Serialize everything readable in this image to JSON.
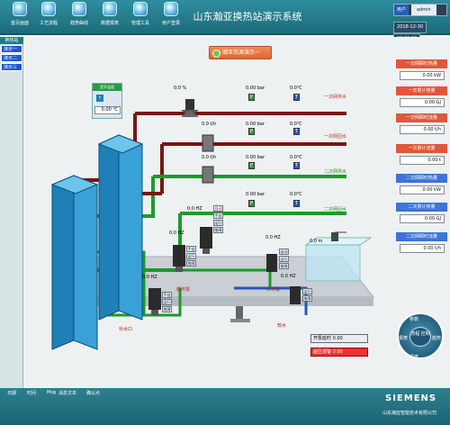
{
  "app": {
    "title": "山东瀚亚换热站演示系统"
  },
  "toolbar": {
    "buttons": [
      {
        "label": "首页画面",
        "icon": "home-icon"
      },
      {
        "label": "工艺流程",
        "icon": "flow-icon"
      },
      {
        "label": "趋势曲线",
        "icon": "chart-icon"
      },
      {
        "label": "数据报表",
        "icon": "report-icon"
      },
      {
        "label": "管理工具",
        "icon": "tools-icon"
      },
      {
        "label": "用户登录",
        "icon": "user-icon"
      }
    ]
  },
  "user": {
    "label": "用户",
    "name": "admin"
  },
  "datetime": {
    "date": "2018-12-30",
    "time": "20:35:15"
  },
  "sidebar": {
    "header": "换热站",
    "items": [
      "演示一",
      "演示二",
      "演示三"
    ]
  },
  "station": {
    "title": "瀚亚热源演示一"
  },
  "temp_box": {
    "title": "室外温度",
    "unit_icon": "t",
    "value": "0.00 ℃"
  },
  "right_panel": [
    {
      "label": "一次网瞬时热量",
      "value": "0.00 kW",
      "color": "red"
    },
    {
      "label": "一次累计热量",
      "value": "0.00 GJ",
      "color": "red"
    },
    {
      "label": "一次网瞬时流量",
      "value": "0.00 t/h",
      "color": "red"
    },
    {
      "label": "一次累计流量",
      "value": "0.00 t",
      "color": "red"
    },
    {
      "label": "二次网瞬时热量",
      "value": "0.00 kW",
      "color": "blue"
    },
    {
      "label": "二次累计热量",
      "value": "0.00 GJ",
      "color": "blue"
    },
    {
      "label": "二次网瞬时流量",
      "value": "0.00 t/h",
      "color": "blue"
    }
  ],
  "pipe_labels": {
    "primary_supply": "一次网供水",
    "primary_return": "一次网回水",
    "secondary_supply": "二次网供水",
    "secondary_return": "二次网回水"
  },
  "readings": {
    "valve_pct": "0.0 %",
    "p1": "0.00 bar",
    "t1": "0.0℃",
    "flow1": "0.0 t/h",
    "p2": "0.00 bar",
    "t2": "0.0℃",
    "flow2": "0.0 t/h",
    "p3": "0.00 bar",
    "t3": "0.0℃",
    "p4": "0.00 bar",
    "t4": "0.0℃",
    "hz_pump1": "0.0 HZ",
    "hz_pump2": "0.0 HZ",
    "hz_pump3": "0.0 HZ",
    "hz_pump4": "0.0 HZ",
    "hz_pump5": "0.0 HZ",
    "tank_level": "0.0 m"
  },
  "pump_state": {
    "auto": "自动",
    "manual": "手动",
    "run": "运行",
    "fault": "故障",
    "hand": "手自"
  },
  "devices": {
    "circ_pump": "循环泵",
    "makeup_pump": "补水泵",
    "softener": "软水",
    "refill_water": "补水口"
  },
  "status_boxes": {
    "pump_state": "开泵延时 0.00",
    "alarm": "超压报警 0.00"
  },
  "round_nav": {
    "top": "参数",
    "right": "趋势",
    "left": "报表",
    "bottom": "报表",
    "center": "流程 控制"
  },
  "bottom": {
    "columns": [
      "日期",
      "时间",
      "Msg",
      "消息文本",
      "确认点"
    ],
    "brand": "SIEMENS",
    "company": "山东瀚亚智能技术有限公司"
  }
}
